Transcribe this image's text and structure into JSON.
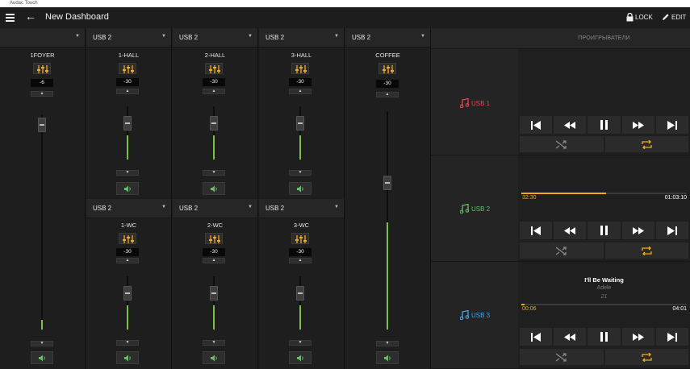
{
  "window": {
    "title": "Audac Touch"
  },
  "appbar": {
    "title": "New Dashboard",
    "lock_label": "LOCK",
    "edit_label": "EDIT"
  },
  "mixer": {
    "columns": [
      {
        "source": "",
        "name": "1FOYER",
        "value": "-6",
        "level": 0.07,
        "knob": 0.06
      },
      {
        "source": "USB 2",
        "name": "1-HALL",
        "value": "-30",
        "level": 0.45,
        "knob": 0.0
      },
      {
        "source": "USB 2",
        "name": "2-HALL",
        "value": "-30",
        "level": 0.45,
        "knob": 0.0
      },
      {
        "source": "USB 2",
        "name": "3-HALL",
        "value": "-30",
        "level": 0.45,
        "knob": 0.0
      },
      {
        "source": "USB 2",
        "name": "COFFEE",
        "value": "-30",
        "level": 0.49,
        "knob": 0.28
      }
    ],
    "row2": [
      {
        "source": "USB 2",
        "name": "1-WC",
        "value": "-30",
        "level": 0.45
      },
      {
        "source": "USB 2",
        "name": "2-WC",
        "value": "-30",
        "level": 0.45
      },
      {
        "source": "USB 2",
        "name": "3-WC",
        "value": "-30",
        "level": 0.45
      }
    ]
  },
  "sources": [
    {
      "label": "USB 1",
      "color": "#e64553"
    },
    {
      "label": "USB 2",
      "color": "#66bb6a"
    },
    {
      "label": "USB 3",
      "color": "#3ea6e8"
    }
  ],
  "players": {
    "header": "ПРОИГРЫВАТЕЛИ",
    "items": [
      {
        "elapsed": "",
        "total": "",
        "progress": 0,
        "song": "",
        "artist": "",
        "track": ""
      },
      {
        "elapsed": "32:30",
        "total": "01:03:10",
        "progress": 0.51,
        "song": "",
        "artist": "",
        "track": ""
      },
      {
        "elapsed": "00:06",
        "total": "04:01",
        "progress": 0.02,
        "song": "I'll Be Waiting",
        "artist": "Adele",
        "track": "21"
      }
    ]
  },
  "colors": {
    "accent": "#f3a91c",
    "level": "#7ac143",
    "usb1": "#e64553",
    "usb2": "#66bb6a",
    "usb3": "#3ea6e8"
  }
}
